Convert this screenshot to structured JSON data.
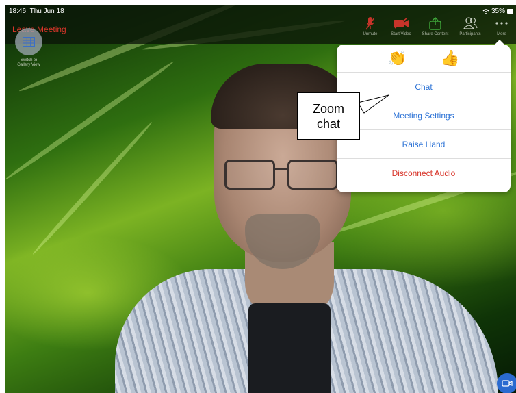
{
  "status_bar": {
    "time": "18:46",
    "date": "Thu Jun 18",
    "battery": "35%"
  },
  "top_bar": {
    "leave_label": "Leave Meeting",
    "tools": [
      {
        "label": "Unmute",
        "icon": "mic-muted-icon"
      },
      {
        "label": "Start Video",
        "icon": "video-off-icon"
      },
      {
        "label": "Share Content",
        "icon": "share-icon"
      },
      {
        "label": "Participants",
        "icon": "participants-icon"
      },
      {
        "label": "More",
        "icon": "more-icon"
      }
    ]
  },
  "gallery": {
    "label_line1": "Switch to",
    "label_line2": "Gallery View"
  },
  "more_menu": {
    "reactions": [
      "👏",
      "👍"
    ],
    "items": [
      "Chat",
      "Meeting Settings",
      "Raise Hand",
      "Disconnect Audio"
    ]
  },
  "callout": {
    "line1": "Zoom",
    "line2": "chat"
  },
  "colors": {
    "danger": "#d8352a",
    "link": "#2d73d6",
    "camera_button": "#2a6ad0"
  }
}
